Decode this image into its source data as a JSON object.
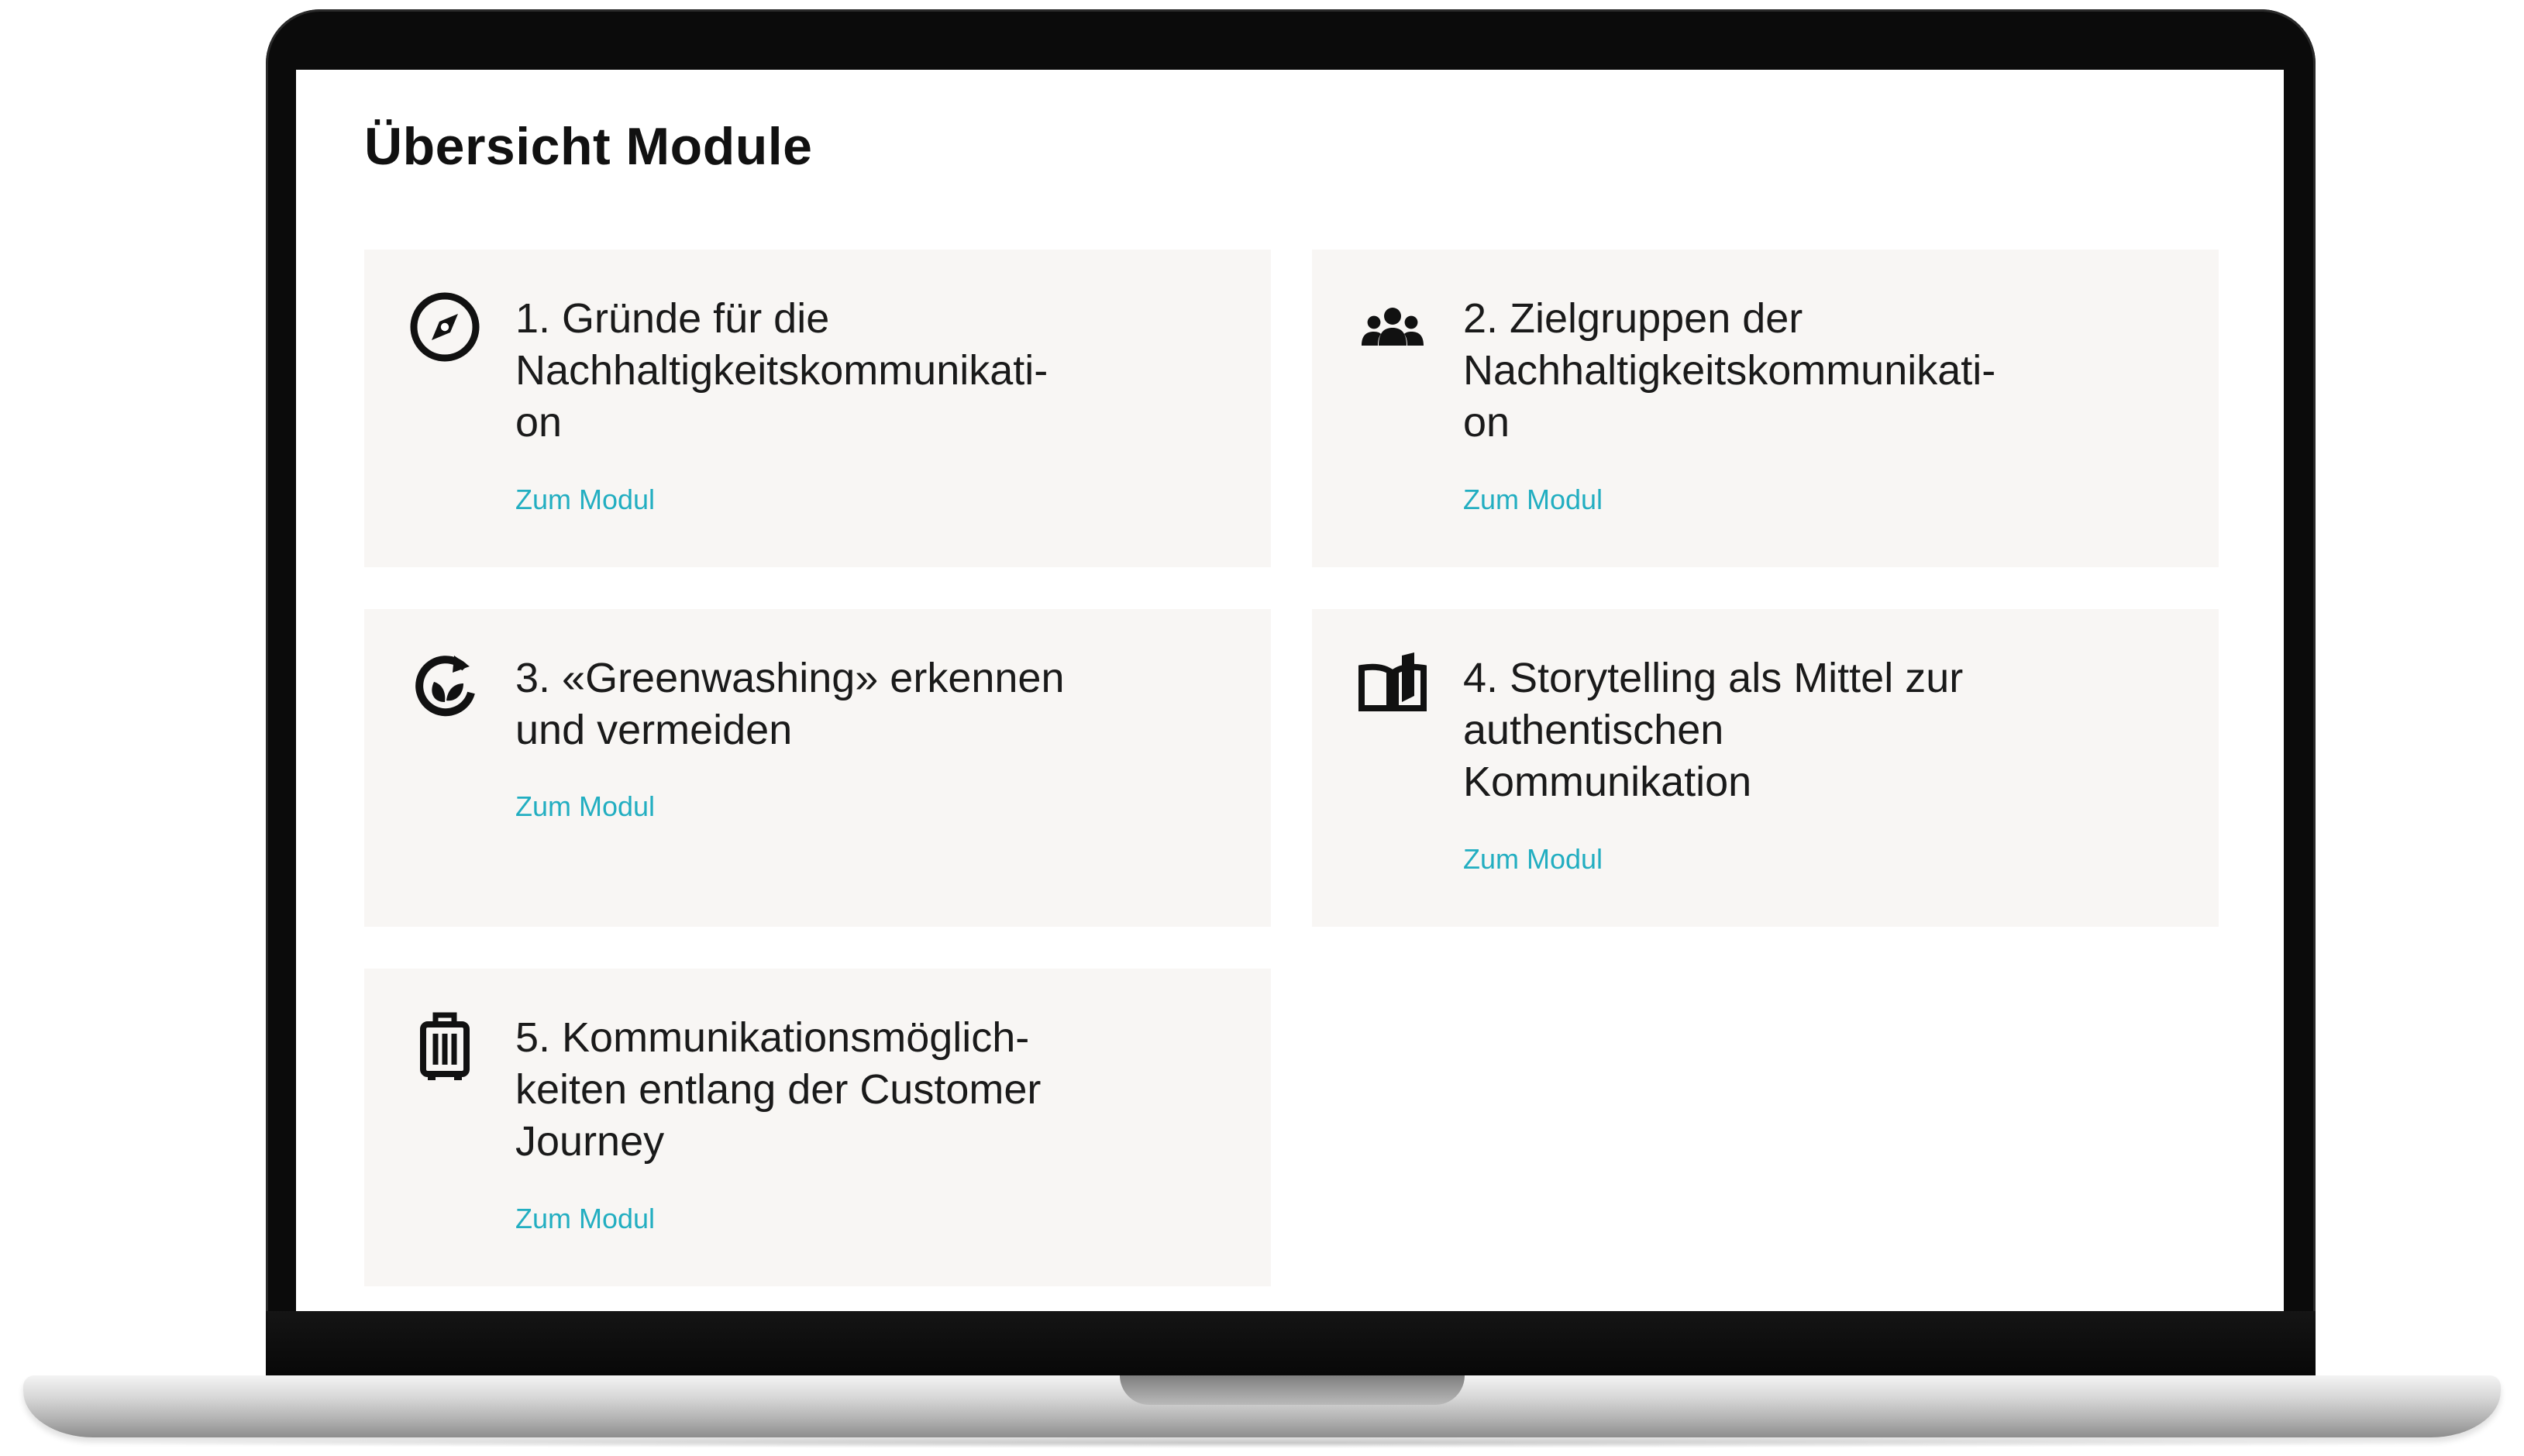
{
  "page": {
    "title": "Übersicht Module"
  },
  "modules": [
    {
      "title": "1. Gründe für die\nNachhaltigkeitskommunikati-\non",
      "link": "Zum Modul",
      "icon": "compass-icon"
    },
    {
      "title": "2. Zielgruppen der\nNachhaltigkeitskommunikati-\non",
      "link": "Zum Modul",
      "icon": "people-group-icon"
    },
    {
      "title": "3. «Greenwashing» erkennen\nund vermeiden",
      "link": "Zum Modul",
      "icon": "recycle-leaf-icon"
    },
    {
      "title": "4. Storytelling als Mittel zur\nauthentischen\nKommunikation",
      "link": "Zum Modul",
      "icon": "open-book-icon"
    },
    {
      "title": "5. Kommunikationsmöglich-\nkeiten entlang der Customer\nJourney",
      "link": "Zum Modul",
      "icon": "luggage-icon"
    }
  ],
  "colors": {
    "accent": "#22aec1",
    "card_background": "#f8f6f4",
    "text": "#1a1a1a"
  }
}
